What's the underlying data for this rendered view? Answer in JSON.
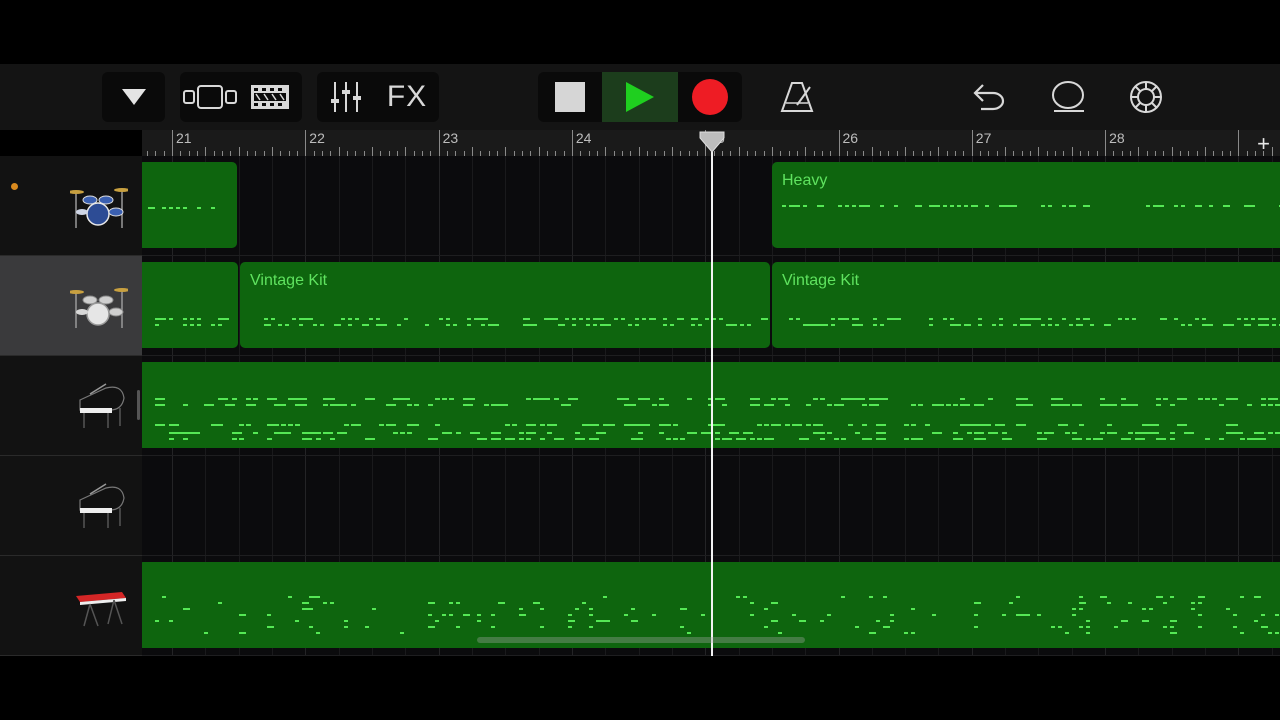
{
  "toolbar": {
    "buttons": [
      {
        "name": "track-menu-button",
        "icon": "triangle-down-icon"
      },
      {
        "name": "tracks-view-button",
        "icon": "tracks-view-icon"
      },
      {
        "name": "smart-controls-button",
        "icon": "filmstrip-icon"
      },
      {
        "name": "mixer-button",
        "icon": "sliders-icon"
      },
      {
        "name": "fx-button",
        "label": "FX"
      },
      {
        "name": "stop-button",
        "icon": "stop-icon"
      },
      {
        "name": "play-button",
        "icon": "play-icon"
      },
      {
        "name": "record-button",
        "icon": "record-icon"
      },
      {
        "name": "metronome-button",
        "icon": "metronome-icon"
      },
      {
        "name": "undo-button",
        "icon": "undo-icon"
      },
      {
        "name": "loop-browser-button",
        "icon": "loop-icon"
      },
      {
        "name": "settings-button",
        "icon": "gear-icon"
      }
    ],
    "fx_label": "FX",
    "play_color": "#1fcf1f",
    "record_color": "#ee1c24"
  },
  "ruler": {
    "bars": [
      "21",
      "22",
      "23",
      "24",
      "25",
      "26",
      "27",
      "28"
    ],
    "add_label": "+"
  },
  "tracks": [
    {
      "instrument": "drum-kit-icon",
      "selected": false,
      "record_enabled": true
    },
    {
      "instrument": "drum-kit-icon",
      "selected": true,
      "record_enabled": false
    },
    {
      "instrument": "grand-piano-icon",
      "selected": false,
      "record_enabled": false
    },
    {
      "instrument": "grand-piano-icon",
      "selected": false,
      "record_enabled": false
    },
    {
      "instrument": "keyboard-synth-icon",
      "selected": false,
      "record_enabled": false
    }
  ],
  "regions": [
    {
      "track": 0,
      "label": ""
    },
    {
      "track": 0,
      "label": "Heavy"
    },
    {
      "track": 1,
      "label": ""
    },
    {
      "track": 1,
      "label": "Vintage Kit"
    },
    {
      "track": 1,
      "label": ""
    },
    {
      "track": 1,
      "label": "Vintage Kit"
    },
    {
      "track": 2,
      "label": ""
    },
    {
      "track": 4,
      "label": ""
    }
  ],
  "colors": {
    "region_fill": "#0e650e",
    "region_label": "#5fe35f",
    "note": "#55e855",
    "record_dot": "#d98a1e"
  }
}
